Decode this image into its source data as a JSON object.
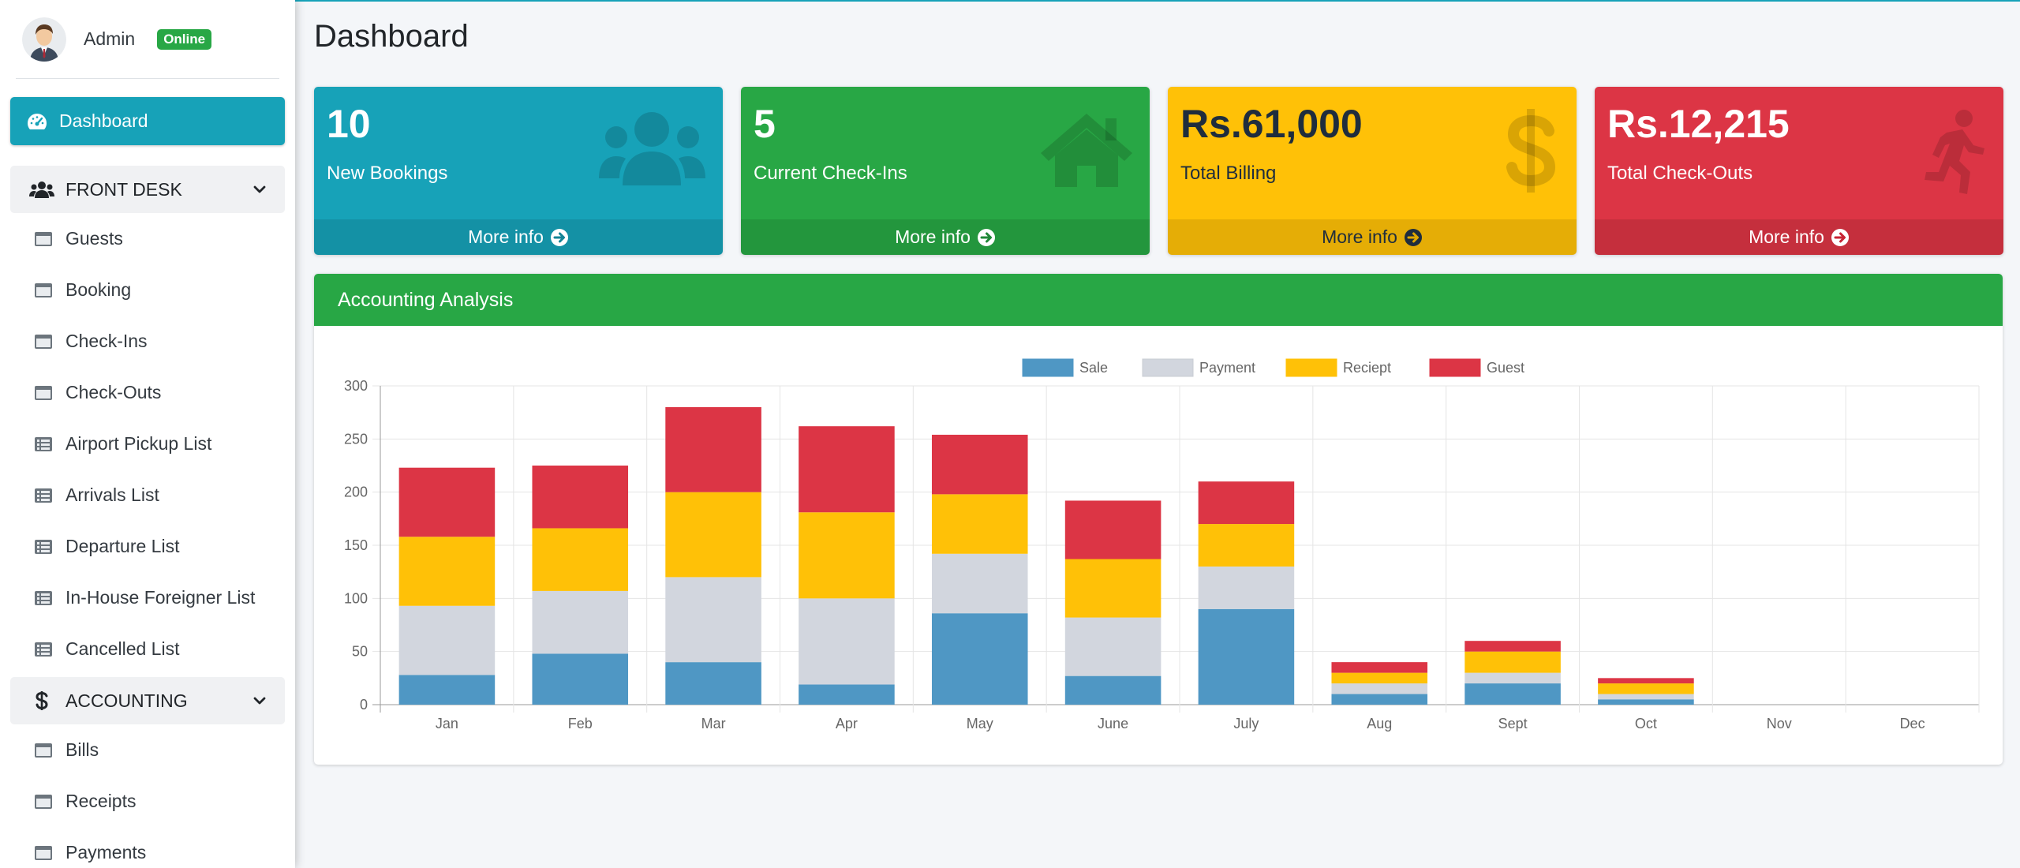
{
  "user": {
    "name": "Admin",
    "status": "Online"
  },
  "nav": {
    "active": "Dashboard",
    "front_desk": {
      "label": "FRONT DESK",
      "items": [
        "Guests",
        "Booking",
        "Check-Ins",
        "Check-Outs",
        "Airport Pickup List",
        "Arrivals List",
        "Departure List",
        "In-House Foreigner List",
        "Cancelled List"
      ]
    },
    "accounting": {
      "label": "ACCOUNTING",
      "items": [
        "Bills",
        "Receipts",
        "Payments"
      ]
    }
  },
  "page": {
    "title": "Dashboard"
  },
  "boxes": [
    {
      "value": "10",
      "label": "New Bookings",
      "link": "More info",
      "color": "#17a2b8",
      "icon": "users-icon"
    },
    {
      "value": "5",
      "label": "Current Check-Ins",
      "link": "More info",
      "color": "#28a745",
      "icon": "home-icon"
    },
    {
      "value": "Rs.61,000",
      "label": "Total Billing",
      "link": "More info",
      "color": "#ffc107",
      "icon": "dollar-icon"
    },
    {
      "value": "Rs.12,215",
      "label": "Total Check-Outs",
      "link": "More info",
      "color": "#dc3545",
      "icon": "running-icon"
    }
  ],
  "card": {
    "title": "Accounting Analysis"
  },
  "chart_data": {
    "type": "bar",
    "stacked": true,
    "categories": [
      "Jan",
      "Feb",
      "Mar",
      "Apr",
      "May",
      "June",
      "July",
      "Aug",
      "Sept",
      "Oct",
      "Nov",
      "Dec"
    ],
    "series": [
      {
        "name": "Sale",
        "color": "#4f97c4",
        "values": [
          28,
          48,
          40,
          19,
          86,
          27,
          90,
          10,
          20,
          5,
          0,
          0
        ]
      },
      {
        "name": "Payment",
        "color": "#d2d6de",
        "values": [
          65,
          59,
          80,
          81,
          56,
          55,
          40,
          10,
          10,
          5,
          0,
          0
        ]
      },
      {
        "name": "Reciept",
        "color": "#ffc107",
        "values": [
          65,
          59,
          80,
          81,
          56,
          55,
          40,
          10,
          20,
          10,
          0,
          0
        ]
      },
      {
        "name": "Guest",
        "color": "#dc3545",
        "values": [
          65,
          59,
          80,
          81,
          56,
          55,
          40,
          10,
          10,
          5,
          0,
          0
        ]
      }
    ],
    "ylim": [
      0,
      300
    ],
    "yticks": [
      0,
      50,
      100,
      150,
      200,
      250,
      300
    ],
    "grid": true,
    "legend": "top-center"
  }
}
